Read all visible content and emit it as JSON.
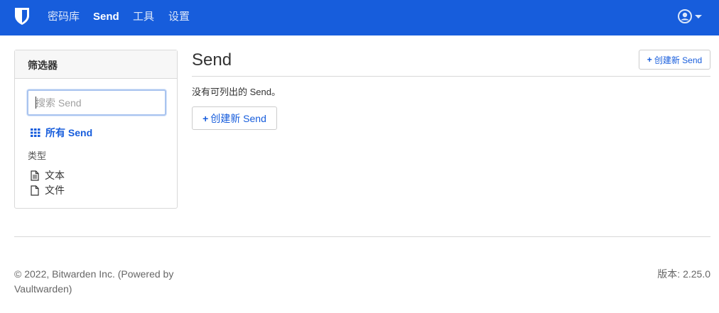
{
  "nav": {
    "brand_icon": "shield-icon",
    "items": [
      {
        "label": "密码库",
        "active": false
      },
      {
        "label": "Send",
        "active": true
      },
      {
        "label": "工具",
        "active": false
      },
      {
        "label": "设置",
        "active": false
      }
    ],
    "user_icon": "user-circle-icon",
    "accent_color": "#175ddc"
  },
  "sidebar": {
    "title": "筛选器",
    "search_placeholder": "搜索 Send",
    "all_send_label": "所有 Send",
    "all_send_icon": "grid-icon",
    "type_heading": "类型",
    "types": [
      {
        "label": "文本",
        "icon": "file-text-icon"
      },
      {
        "label": "文件",
        "icon": "file-icon"
      }
    ]
  },
  "main": {
    "title": "Send",
    "create_button_label": "创建新 Send",
    "empty_message": "没有可列出的 Send。",
    "create_button_main_label": "创建新 Send"
  },
  "footer": {
    "copyright": "© 2022, Bitwarden Inc. (Powered by Vaultwarden)",
    "version": "版本: 2.25.0"
  }
}
